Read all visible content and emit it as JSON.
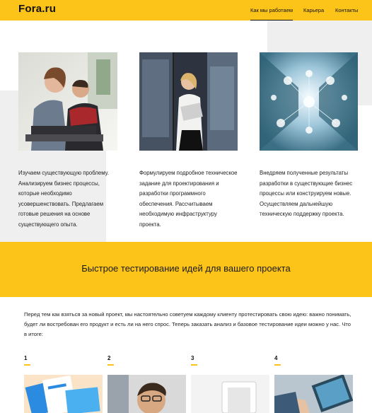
{
  "header": {
    "logo": "Fora.ru",
    "nav": [
      {
        "label": "Как мы работаем",
        "active": true
      },
      {
        "label": "Карьера",
        "active": false
      },
      {
        "label": "Контакты",
        "active": false
      }
    ]
  },
  "cards": [
    {
      "image": "team-at-laptop-photo",
      "text": "Изучаем существующую проблему. Анализируем бизнес процессы, которые необходимо усовершенствовать. Предлагаем готовые решения на основе существующего опыта."
    },
    {
      "image": "woman-office-corridor-photo",
      "text": "Формулируем подробное техническое задание для проектирования и разработки программного обеспечения. Рассчитываем необходимую инфраструктуру проекта."
    },
    {
      "image": "server-room-network-photo",
      "text": "Внедряем полученные результаты разработки в существующие бизнес процессы или конструируем новые. Осуществляем дальнейшую техническую поддержку проекта."
    }
  ],
  "band": {
    "title": "Быстрое тестирование идей для вашего проекта"
  },
  "intro": "Перед тем как взяться за новый проект, мы настоятельно советуем каждому клиенту протестировать свою идею: важно понимать, будет ли востребован его продукт и есть ли на него спрос. Теперь заказать анализ и базовое тестирование идеи можно у нас. Что в итоге:",
  "steps": [
    {
      "num": "1",
      "image": "app-screens-photo"
    },
    {
      "num": "2",
      "image": "man-with-glasses-photo"
    },
    {
      "num": "3",
      "image": "device-mockup-photo"
    },
    {
      "num": "4",
      "image": "hands-with-tablet-photo"
    }
  ],
  "colors": {
    "accent": "#fcc419",
    "gray": "#efefef"
  }
}
